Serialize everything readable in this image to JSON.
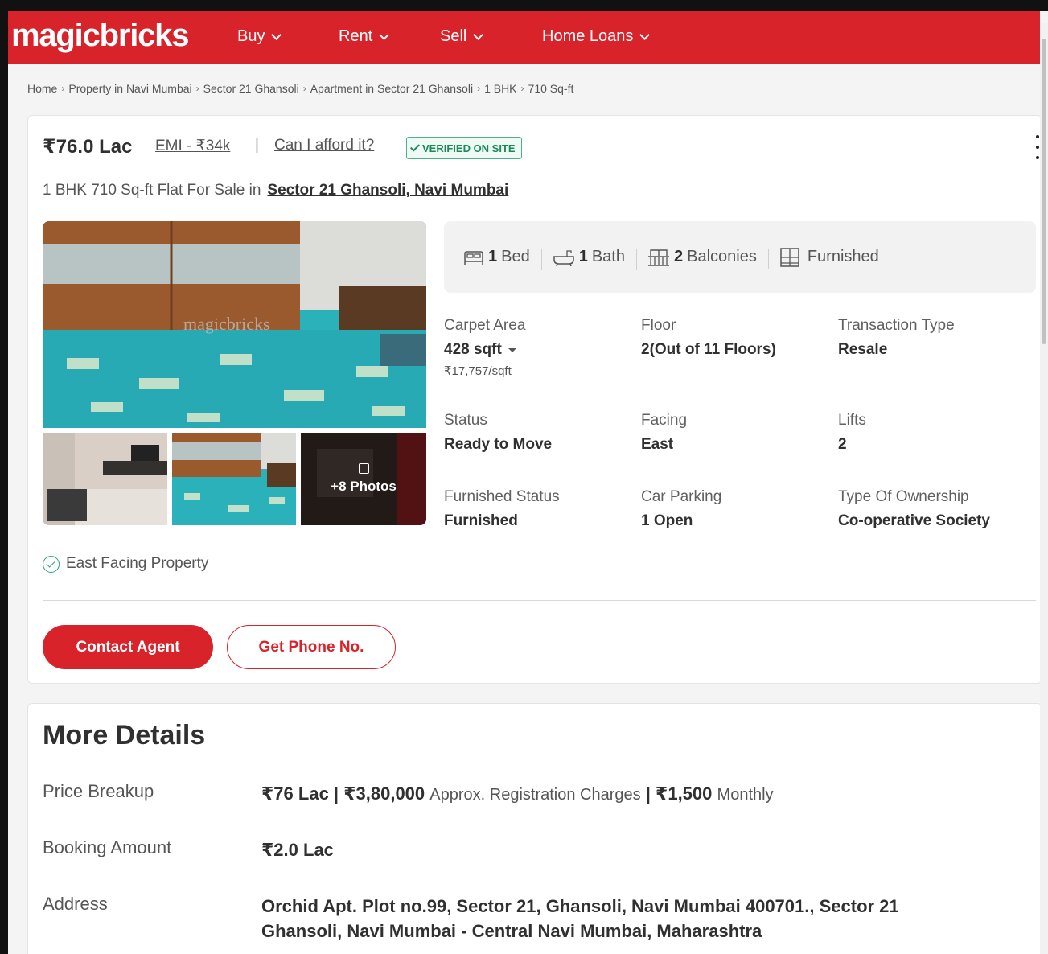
{
  "header": {
    "logo": "magicbricks",
    "nav": [
      {
        "label": "Buy"
      },
      {
        "label": "Rent"
      },
      {
        "label": "Sell"
      },
      {
        "label": "Home Loans"
      }
    ]
  },
  "breadcrumb": [
    "Home",
    "Property in Navi Mumbai",
    "Sector 21 Ghansoli",
    "Apartment in Sector 21 Ghansoli",
    "1 BHK",
    "710 Sq-ft"
  ],
  "listing": {
    "price": "₹76.0 Lac",
    "emi": "EMI - ₹34k",
    "afford": "Can I afford it?",
    "verified": "VERIFIED ON SITE",
    "title_prefix": "1 BHK 710 Sq-ft Flat For Sale in",
    "location": "Sector 21 Ghansoli, Navi Mumbai",
    "photos_more": "+8 Photos",
    "summary": [
      {
        "icon": "bed-icon",
        "count": "1",
        "label": "Bed"
      },
      {
        "icon": "bath-icon",
        "count": "1",
        "label": "Bath"
      },
      {
        "icon": "balcony-icon",
        "count": "2",
        "label": "Balconies"
      },
      {
        "icon": "furnished-icon",
        "count": "",
        "label": "Furnished"
      }
    ],
    "facts": {
      "carpet_area": {
        "label": "Carpet Area",
        "value": "428 sqft",
        "sub": "₹17,757/sqft"
      },
      "floor": {
        "label": "Floor",
        "value": "2(Out of 11 Floors)"
      },
      "transaction": {
        "label": "Transaction Type",
        "value": "Resale"
      },
      "status": {
        "label": "Status",
        "value": "Ready to Move"
      },
      "facing": {
        "label": "Facing",
        "value": "East"
      },
      "lifts": {
        "label": "Lifts",
        "value": "2"
      },
      "furnished_status": {
        "label": "Furnished Status",
        "value": "Furnished"
      },
      "car_parking": {
        "label": "Car Parking",
        "value": "1 Open"
      },
      "ownership": {
        "label": "Type Of Ownership",
        "value": "Co-operative Society"
      }
    },
    "highlight": "East Facing Property",
    "contact_button": "Contact Agent",
    "phone_button": "Get Phone No."
  },
  "more_details": {
    "title": "More Details",
    "price_breakup": {
      "label": "Price Breakup",
      "price": "₹76 Lac",
      "registration": "₹3,80,000",
      "registration_label": "Approx. Registration Charges",
      "monthly": "₹1,500",
      "monthly_label": "Monthly"
    },
    "booking": {
      "label": "Booking Amount",
      "value": "₹2.0 Lac"
    },
    "address": {
      "label": "Address",
      "value": "Orchid Apt. Plot no.99, Sector 21, Ghansoli, Navi Mumbai 400701., Sector 21 Ghansoli, Navi Mumbai - Central Navi Mumbai, Maharashtra"
    }
  },
  "colors": {
    "brand": "#d8232a",
    "verified": "#1a8a5a"
  }
}
